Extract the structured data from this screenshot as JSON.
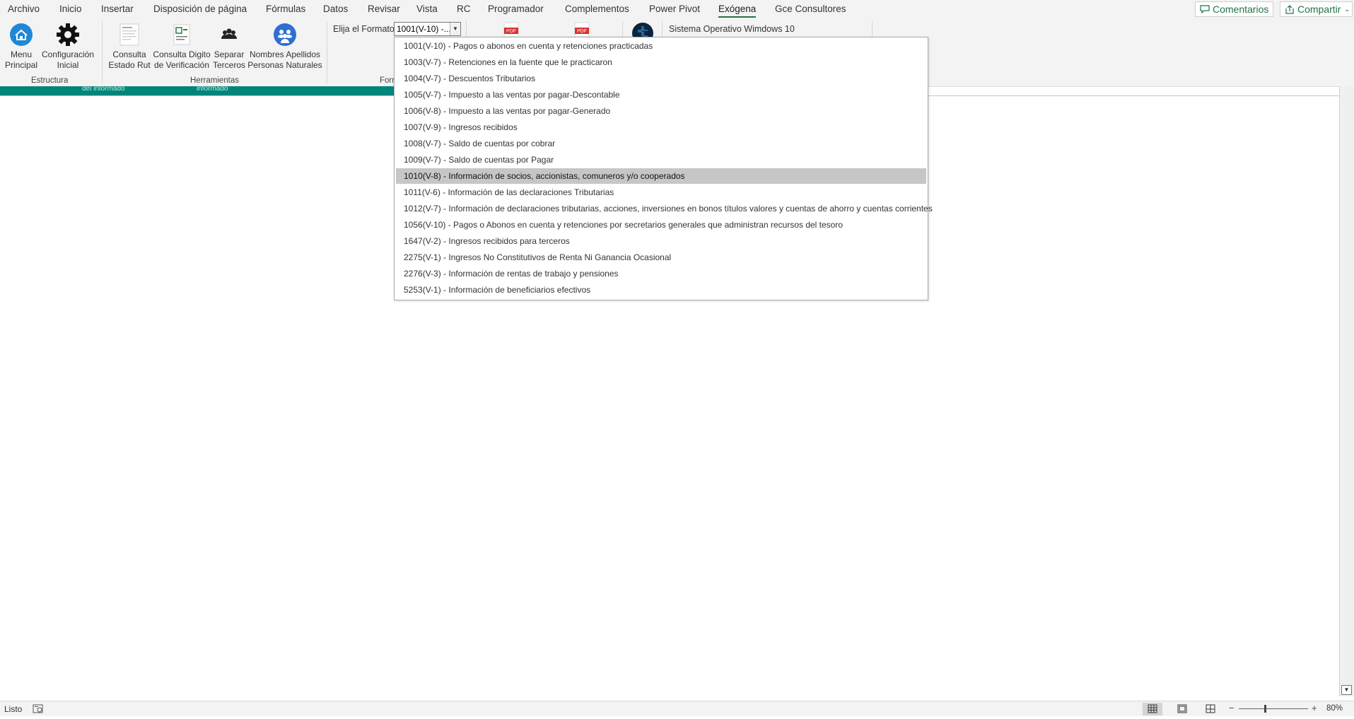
{
  "tabs": [
    "Archivo",
    "Inicio",
    "Insertar",
    "Disposición de página",
    "Fórmulas",
    "Datos",
    "Revisar",
    "Vista",
    "RC",
    "Programador",
    "Complementos",
    "Power Pivot",
    "Exógena",
    "Gce Consultores"
  ],
  "active_tab": "Exógena",
  "top_buttons": {
    "comments": "Comentarios",
    "share": "Compartir"
  },
  "ribbon": {
    "buttons": {
      "menu_principal": [
        "Menu",
        "Principal"
      ],
      "configuracion_inicial": [
        "Configuración",
        "Inicial"
      ],
      "consulta_estado_rut": [
        "Consulta",
        "Estado Rut"
      ],
      "consulta_digito": [
        "Consulta Digito",
        "de Verificación"
      ],
      "separar_terceros": [
        "Separar",
        "Terceros"
      ],
      "nombres_apellidos": [
        "Nombres Apellidos",
        "Personas Naturales"
      ]
    },
    "groups": {
      "estructura": "Estructura",
      "herramientas": "Herramientas",
      "formato_partial": "Forr"
    },
    "format_label": "Elija el Formato",
    "format_value": "1001(V-10) -...",
    "os_label": "Sistema Operativo Wimdows 10"
  },
  "sheet_band_text": [
    "del informado",
    "informado"
  ],
  "dropdown": {
    "selected_index": 8,
    "items": [
      "1001(V-10) - Pagos o abonos en cuenta y retenciones practicadas",
      "1003(V-7) - Retenciones en la fuente que le practicaron",
      "1004(V-7) - Descuentos Tributarios",
      "1005(V-7) - Impuesto a las ventas por pagar-Descontable",
      "1006(V-8) - Impuesto a las ventas por pagar-Generado",
      "1007(V-9) - Ingresos recibidos",
      "1008(V-7) - Saldo de cuentas por cobrar",
      "1009(V-7) - Saldo de cuentas por Pagar",
      "1010(V-8) - Información de socios,  accionistas, comuneros y/o cooperados",
      "1011(V-6) - Información de las declaraciones Tributarias",
      "1012(V-7) - Información de declaraciones tributarias, acciones, inversiones en bonos títulos valores y cuentas de ahorro y cuentas corrientes",
      "1056(V-10) - Pagos o Abonos en cuenta y retenciones por secretarios generales que administran recursos del tesoro",
      "1647(V-2) - Ingresos recibidos para terceros",
      "2275(V-1) - Ingresos No Constitutivos de Renta Ni Ganancia Ocasional",
      "2276(V-3) - Información de rentas de trabajo y pensiones",
      "5253(V-1) - Información de beneficiarios efectivos"
    ]
  },
  "status": {
    "ready": "Listo",
    "zoom": "80%",
    "zoom_out": "−",
    "zoom_in": "+"
  },
  "colors": {
    "accent": "#217346",
    "band": "#00857a",
    "selected": "#c6c6c6"
  }
}
